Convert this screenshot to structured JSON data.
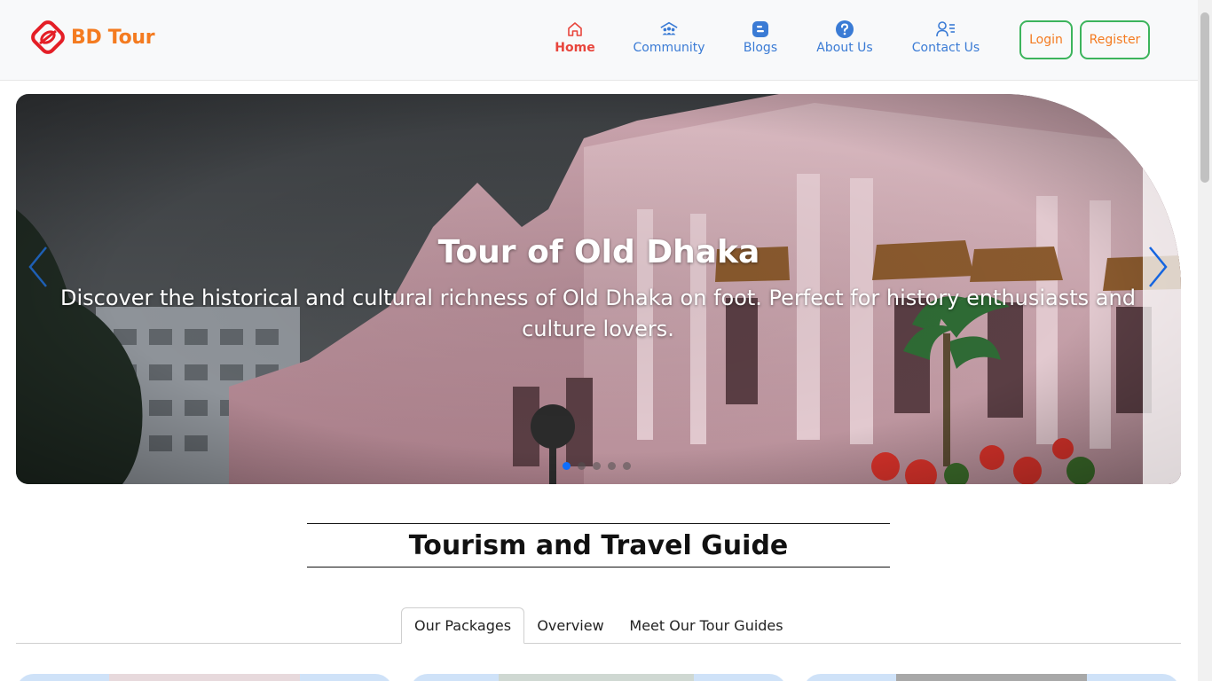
{
  "brand": {
    "name": "BD Tour",
    "logo_icon": "bd-tour-logo-icon",
    "color": "#f47b20"
  },
  "nav": {
    "items": [
      {
        "label": "Home",
        "icon": "home-icon",
        "active": true
      },
      {
        "label": "Community",
        "icon": "community-icon",
        "active": false
      },
      {
        "label": "Blogs",
        "icon": "blogger-icon",
        "active": false
      },
      {
        "label": "About Us",
        "icon": "question-circle-icon",
        "active": false
      },
      {
        "label": "Contact Us",
        "icon": "contact-person-icon",
        "active": false
      }
    ],
    "active_color": "#e8453c",
    "link_color": "#3a7bd5"
  },
  "auth": {
    "login_label": "Login",
    "register_label": "Register",
    "border_color": "#3cb45c"
  },
  "hero": {
    "title": "Tour of Old Dhaka",
    "text": "Discover the historical and cultural richness of Old Dhaka on foot. Perfect for history enthusiasts and culture lovers.",
    "prev_icon": "chevron-left-icon",
    "next_icon": "chevron-right-icon",
    "slide_count": 5,
    "active_slide": 1
  },
  "section": {
    "title": "Tourism and Travel Guide"
  },
  "tabs": [
    {
      "label": "Our Packages",
      "active": true
    },
    {
      "label": "Overview",
      "active": false
    },
    {
      "label": "Meet Our Tour Guides",
      "active": false
    }
  ]
}
